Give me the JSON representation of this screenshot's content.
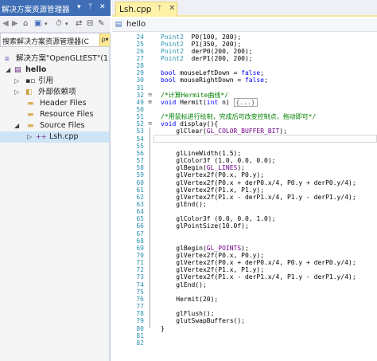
{
  "solution_explorer": {
    "title": "解决方案资源管理器",
    "controls": {
      "dropdown": "▾",
      "pin": "ᛘ",
      "close": "✕"
    },
    "search": {
      "text": "搜索解决方案资源管理器(C",
      "button": "ρ▾"
    },
    "tree": [
      {
        "label": "解决方案\"OpenGLtEST\"(1",
        "icon": "solution-icon"
      },
      {
        "label": "hello",
        "icon": "project-icon"
      },
      {
        "label": "引用",
        "icon": "references-icon"
      },
      {
        "label": "外部依赖项",
        "icon": "external-deps-icon"
      },
      {
        "label": "Header Files",
        "icon": "folder-icon"
      },
      {
        "label": "Resource Files",
        "icon": "folder-icon"
      },
      {
        "label": "Source Files",
        "icon": "folder-icon"
      },
      {
        "label": "Lsh.cpp",
        "icon": "cpp-file-icon"
      }
    ]
  },
  "editor": {
    "tab": {
      "label": "Lsh.cpp",
      "pin": "ᛘ",
      "close": "✕"
    },
    "navbar": {
      "project": "hello"
    },
    "code_lines": [
      {
        "n": "24",
        "t": [
          [
            "ty",
            "Point2"
          ],
          [
            "",
            "  P0(100, 200);"
          ]
        ]
      },
      {
        "n": "25",
        "t": [
          [
            "ty",
            "Point2"
          ],
          [
            "",
            "  P1(350, 200);"
          ]
        ]
      },
      {
        "n": "26",
        "t": [
          [
            "ty",
            "Point2"
          ],
          [
            "",
            "  derP0(200, 200);"
          ]
        ]
      },
      {
        "n": "27",
        "t": [
          [
            "ty",
            "Point2"
          ],
          [
            "",
            "  derP1(200, 200);"
          ]
        ]
      },
      {
        "n": "28",
        "t": []
      },
      {
        "n": "29",
        "t": [
          [
            "kw",
            "bool"
          ],
          [
            "",
            " mouseLeftDown = "
          ],
          [
            "kw",
            "false"
          ],
          [
            "",
            ";"
          ]
        ]
      },
      {
        "n": "30",
        "t": [
          [
            "kw",
            "bool"
          ],
          [
            "",
            " mouseRightDown = "
          ],
          [
            "kw",
            "false"
          ],
          [
            "",
            ";"
          ]
        ]
      },
      {
        "n": "31",
        "t": []
      },
      {
        "n": "32",
        "t": [
          [
            "cm",
            "/*计算Hermite曲线*/"
          ]
        ]
      },
      {
        "n": "49",
        "t": [
          [
            "kw",
            "void"
          ],
          [
            "",
            " Hermit("
          ],
          [
            "kw",
            "int"
          ],
          [
            "",
            " n)"
          ]
        ],
        "box": "{...}"
      },
      {
        "n": "50",
        "t": []
      },
      {
        "n": "51",
        "t": [
          [
            "cm",
            "/*用鼠标进行绘制，完成后可改变控制点，拖动即可*/"
          ]
        ]
      },
      {
        "n": "52",
        "t": [
          [
            "kw",
            "void"
          ],
          [
            "",
            " display(){"
          ]
        ]
      },
      {
        "n": "53",
        "t": [
          [
            "",
            "    glClear("
          ],
          [
            "mc",
            "GL_COLOR_BUFFER_BIT"
          ],
          [
            "",
            ");"
          ]
        ]
      },
      {
        "n": "54",
        "t": [
          [
            "",
            "    "
          ]
        ]
      },
      {
        "n": "55",
        "t": []
      },
      {
        "n": "56",
        "t": [
          [
            "",
            "    glLineWidth(1.5);"
          ]
        ]
      },
      {
        "n": "57",
        "t": [
          [
            "",
            "    glColor3f (1.0, 0.0, 0.0);"
          ]
        ]
      },
      {
        "n": "58",
        "t": [
          [
            "",
            "    glBegin("
          ],
          [
            "mc",
            "GL_LINES"
          ],
          [
            "",
            ");"
          ]
        ]
      },
      {
        "n": "59",
        "t": [
          [
            "",
            "    glVertex2f(P0.x, P0.y);"
          ]
        ]
      },
      {
        "n": "60",
        "t": [
          [
            "",
            "    glVertex2f(P0.x + derP0.x/4, P0.y + derP0.y/4);"
          ]
        ]
      },
      {
        "n": "61",
        "t": [
          [
            "",
            "    glVertex2f(P1.x, P1.y);"
          ]
        ]
      },
      {
        "n": "62",
        "t": [
          [
            "",
            "    glVertex2f(P1.x - derP1.x/4, P1.y - derP1.y/4);"
          ]
        ]
      },
      {
        "n": "63",
        "t": [
          [
            "",
            "    glEnd();"
          ]
        ]
      },
      {
        "n": "64",
        "t": []
      },
      {
        "n": "65",
        "t": [
          [
            "",
            "    glColor3f (0.0, 0.0, 1.0);"
          ]
        ]
      },
      {
        "n": "66",
        "t": [
          [
            "",
            "    glPointSize(10.0f);"
          ]
        ]
      },
      {
        "n": "67",
        "t": []
      },
      {
        "n": "68",
        "t": []
      },
      {
        "n": "69",
        "t": [
          [
            "",
            "    glBegin("
          ],
          [
            "mc",
            "GL_POINTS"
          ],
          [
            "",
            ");"
          ]
        ]
      },
      {
        "n": "70",
        "t": [
          [
            "",
            "    glVertex2f(P0.x, P0.y);"
          ]
        ]
      },
      {
        "n": "71",
        "t": [
          [
            "",
            "    glVertex2f(P0.x + derP0.x/4, P0.y + derP0.y/4);"
          ]
        ]
      },
      {
        "n": "72",
        "t": [
          [
            "",
            "    glVertex2f(P1.x, P1.y);"
          ]
        ]
      },
      {
        "n": "73",
        "t": [
          [
            "",
            "    glVertex2f(P1.x - derP1.x/4, P1.y - derP1.y/4);"
          ]
        ]
      },
      {
        "n": "74",
        "t": [
          [
            "",
            "    glEnd();"
          ]
        ]
      },
      {
        "n": "75",
        "t": []
      },
      {
        "n": "76",
        "t": [
          [
            "",
            "    Hermit(20);"
          ]
        ]
      },
      {
        "n": "77",
        "t": []
      },
      {
        "n": "78",
        "t": [
          [
            "",
            "    glFlush();"
          ]
        ]
      },
      {
        "n": "79",
        "t": [
          [
            "",
            "    glutSwapBuffers();"
          ]
        ]
      },
      {
        "n": "80",
        "t": [
          [
            "",
            "}"
          ]
        ]
      },
      {
        "n": "81",
        "t": []
      },
      {
        "n": "82",
        "t": []
      }
    ]
  }
}
